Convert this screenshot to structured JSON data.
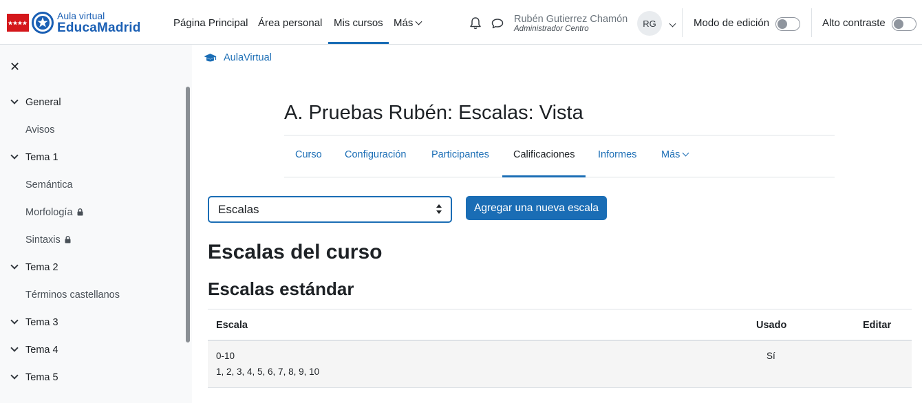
{
  "brand": {
    "small": "Aula virtual",
    "big": "EducaMadrid"
  },
  "nav": {
    "items": [
      "Página Principal",
      "Área personal",
      "Mis cursos",
      "Más"
    ]
  },
  "user": {
    "name": "Rubén Gutierrez Chamón",
    "role": "Administrador Centro",
    "initials": "RG"
  },
  "toggles": {
    "edit_mode": "Modo de edición",
    "high_contrast": "Alto contraste"
  },
  "drawer": {
    "items": [
      {
        "label": "General",
        "kind": "section"
      },
      {
        "label": "Avisos",
        "kind": "activity"
      },
      {
        "label": "Tema 1",
        "kind": "section"
      },
      {
        "label": "Semántica",
        "kind": "activity"
      },
      {
        "label": "Morfología",
        "kind": "activity",
        "locked": true
      },
      {
        "label": "Sintaxis",
        "kind": "activity",
        "locked": true
      },
      {
        "label": "Tema 2",
        "kind": "section"
      },
      {
        "label": "Términos castellanos",
        "kind": "activity"
      },
      {
        "label": "Tema 3",
        "kind": "section"
      },
      {
        "label": "Tema 4",
        "kind": "section"
      },
      {
        "label": "Tema 5",
        "kind": "section"
      }
    ]
  },
  "breadcrumb": "AulaVirtual",
  "page_title": "A. Pruebas Rubén: Escalas: Vista",
  "course_nav": {
    "tabs": [
      "Curso",
      "Configuración",
      "Participantes",
      "Calificaciones",
      "Informes",
      "Más"
    ],
    "active": "Calificaciones"
  },
  "scale_select": {
    "value": "Escalas"
  },
  "add_button": "Agregar una nueva escala",
  "heading_course_scales": "Escalas del curso",
  "heading_standard_scales": "Escalas estándar",
  "table": {
    "headers": [
      "Escala",
      "Usado",
      "Editar"
    ],
    "rows": [
      {
        "name": "0-10",
        "items": "1, 2, 3, 4, 5, 6, 7, 8, 9, 10",
        "used": "Sí"
      }
    ]
  },
  "colors": {
    "primary": "#1a6db5",
    "brand_red": "#d4171b",
    "drawer_bg": "#f8f9fa"
  }
}
